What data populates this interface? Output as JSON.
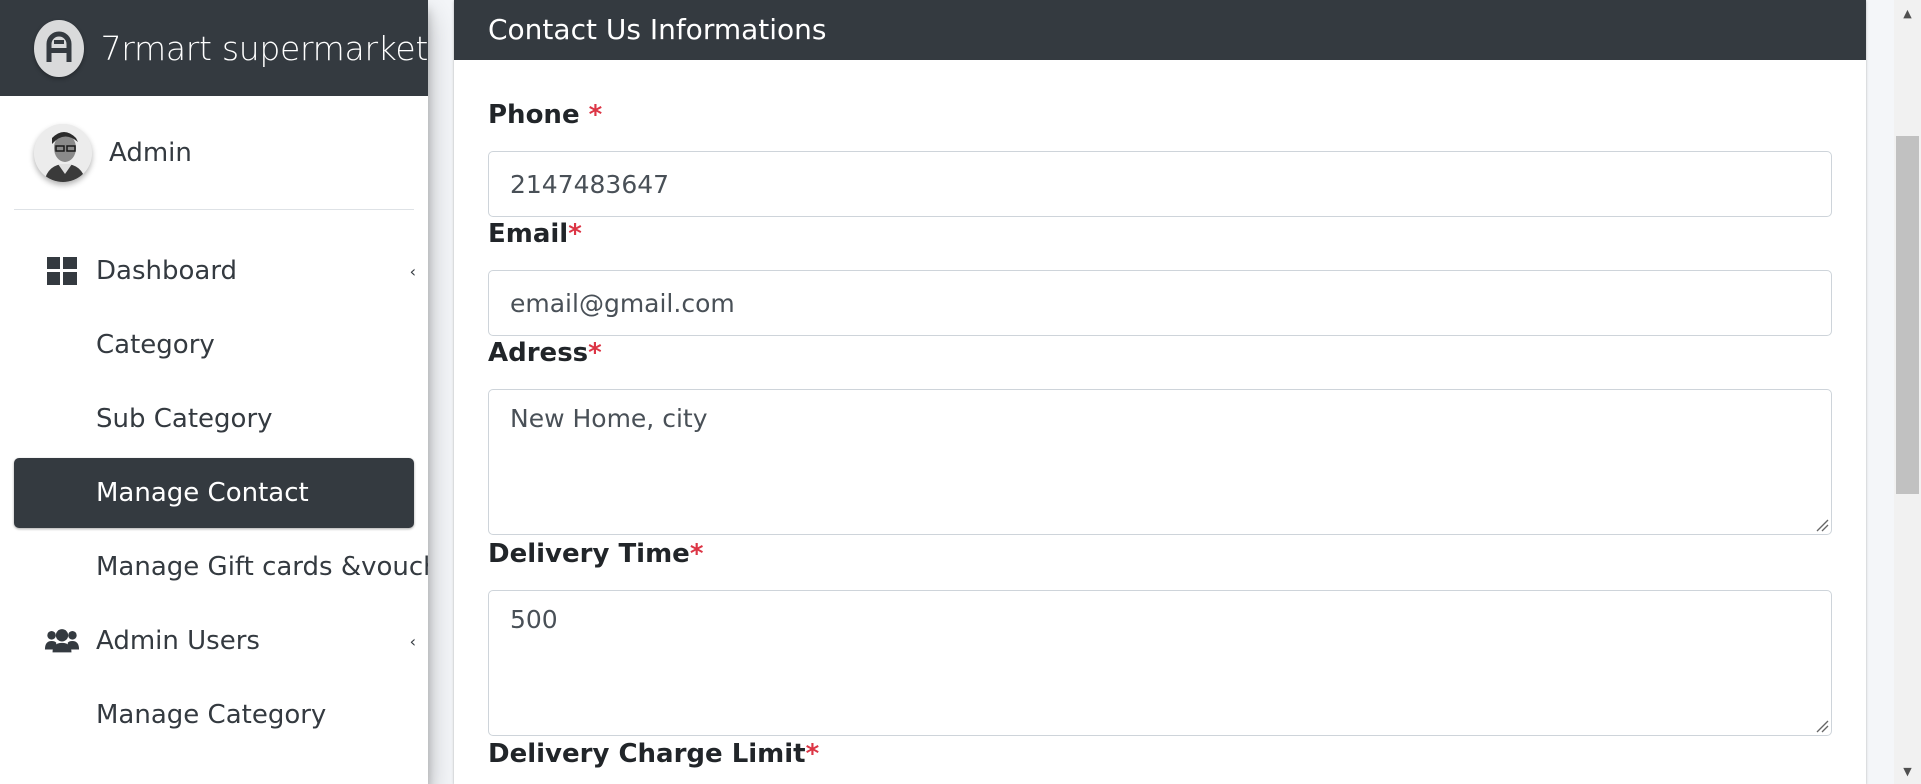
{
  "brand": {
    "name": "7rmart supermarket",
    "logo_icon": "brand-logo-icon"
  },
  "user": {
    "name": "Admin",
    "avatar_icon": "user-avatar"
  },
  "sidebar": {
    "items": [
      {
        "label": "Dashboard",
        "icon": "dashboard-grid-icon",
        "arrow": "‹"
      },
      {
        "label": "Category"
      },
      {
        "label": "Sub Category"
      },
      {
        "label": "Manage Contact",
        "active": true
      },
      {
        "label": "Manage Gift cards &voucher"
      },
      {
        "label": "Admin Users",
        "icon": "users-icon",
        "arrow": "‹"
      },
      {
        "label": "Manage Category"
      }
    ]
  },
  "card": {
    "title": "Contact Us Informations"
  },
  "form": {
    "phone": {
      "label": "Phone ",
      "required": "*",
      "value": "2147483647"
    },
    "email": {
      "label": "Email",
      "required": "*",
      "value": "email@gmail.com"
    },
    "address": {
      "label": "Adress",
      "required": "*",
      "value": "New Home, city"
    },
    "delivery_time": {
      "label": "Delivery Time",
      "required": "*",
      "value": "500"
    },
    "delivery_charge_limit": {
      "label": "Delivery Charge Limit",
      "required": "*"
    }
  },
  "colors": {
    "dark": "#343a40",
    "required": "#dc3545",
    "border": "#ced4da"
  }
}
